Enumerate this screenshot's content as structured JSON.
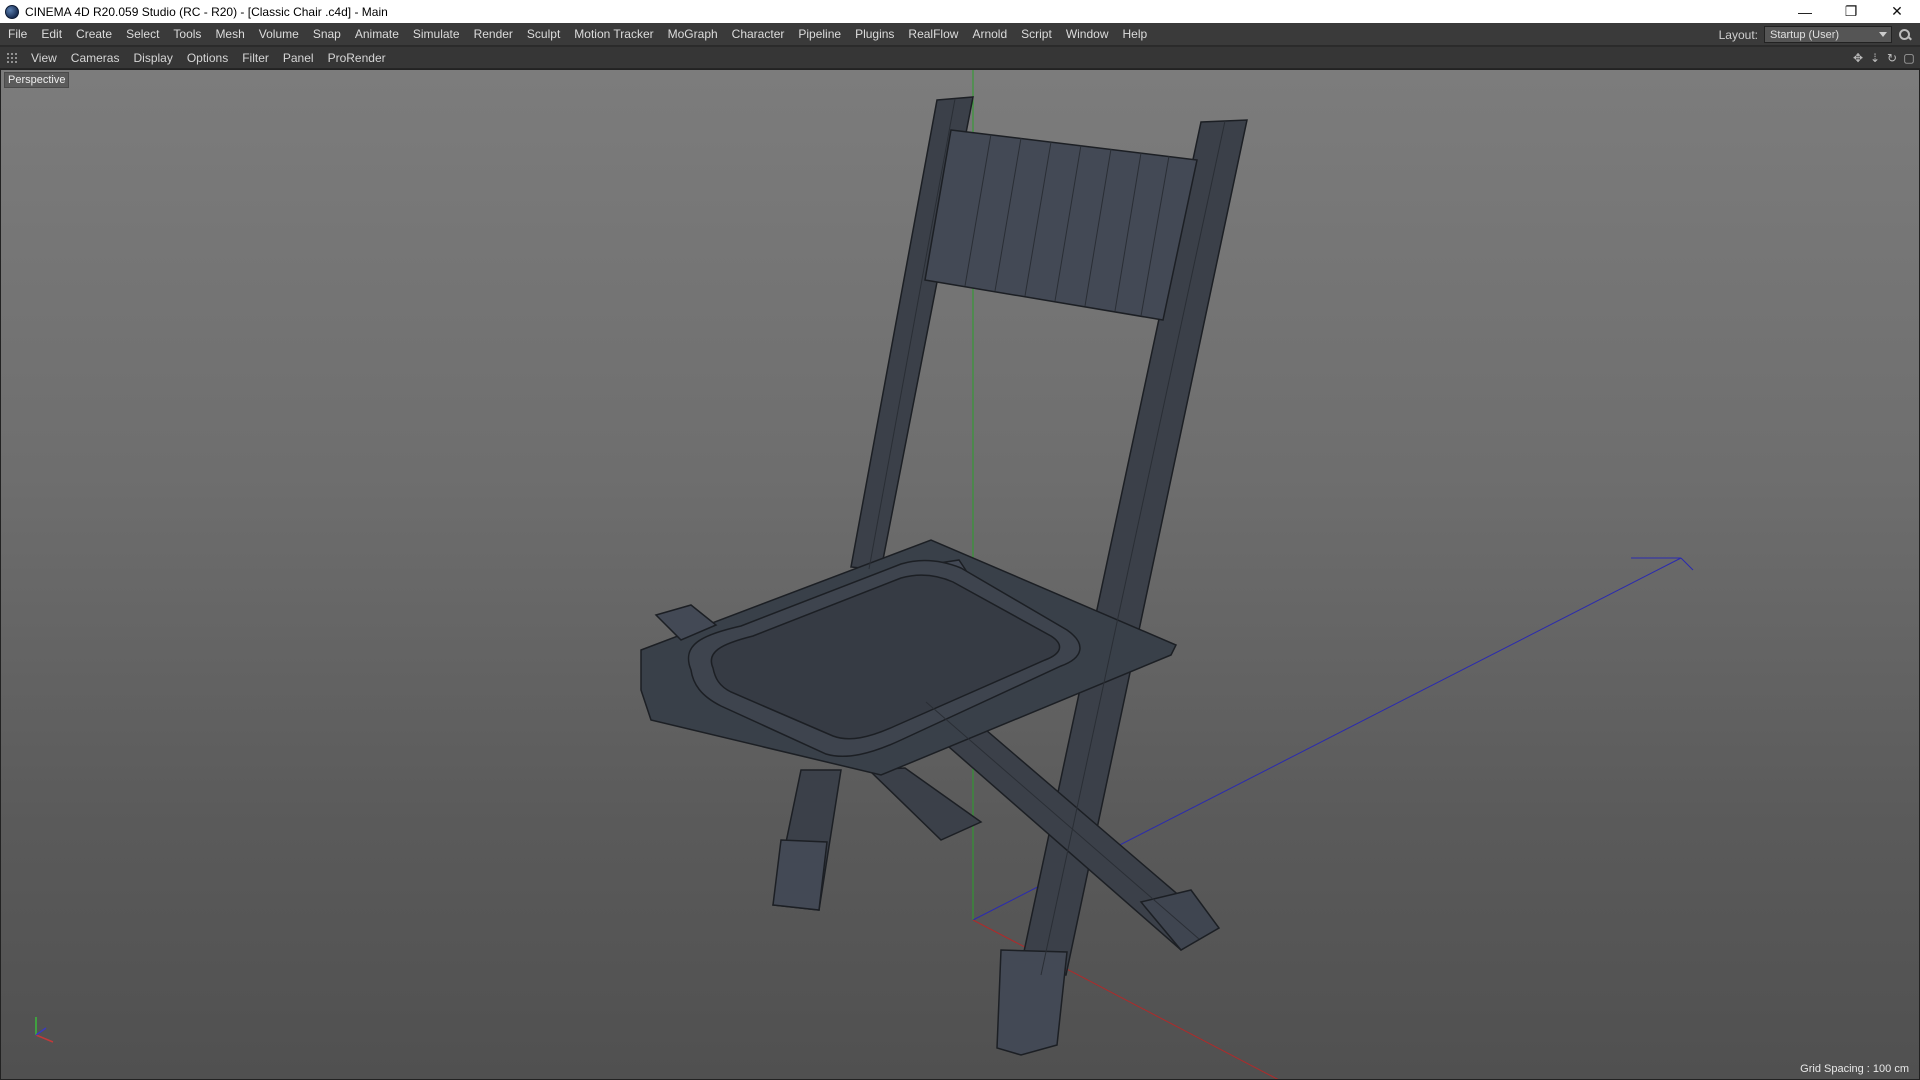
{
  "window": {
    "title": "CINEMA 4D R20.059 Studio (RC - R20) - [Classic Chair .c4d] - Main",
    "controls": {
      "minimize": "—",
      "restore": "❐",
      "close": "✕"
    }
  },
  "menubar": {
    "items": [
      "File",
      "Edit",
      "Create",
      "Select",
      "Tools",
      "Mesh",
      "Volume",
      "Snap",
      "Animate",
      "Simulate",
      "Render",
      "Sculpt",
      "Motion Tracker",
      "MoGraph",
      "Character",
      "Pipeline",
      "Plugins",
      "RealFlow",
      "Arnold",
      "Script",
      "Window",
      "Help"
    ],
    "layout_label": "Layout:",
    "layout_value": "Startup (User)"
  },
  "viewport_menu": {
    "items": [
      "View",
      "Cameras",
      "Display",
      "Options",
      "Filter",
      "Panel",
      "ProRender"
    ],
    "tool_icons": [
      "move-view-icon",
      "zoom-view-icon",
      "rotate-view-icon",
      "maximize-view-icon"
    ]
  },
  "viewport": {
    "camera_label": "Perspective",
    "grid_spacing": "Grid Spacing : 100 cm",
    "axis_colors": {
      "x": "#b02a2a",
      "y": "#2aa02a",
      "z": "#2a2ab0"
    },
    "model_color": "#3b4049"
  }
}
